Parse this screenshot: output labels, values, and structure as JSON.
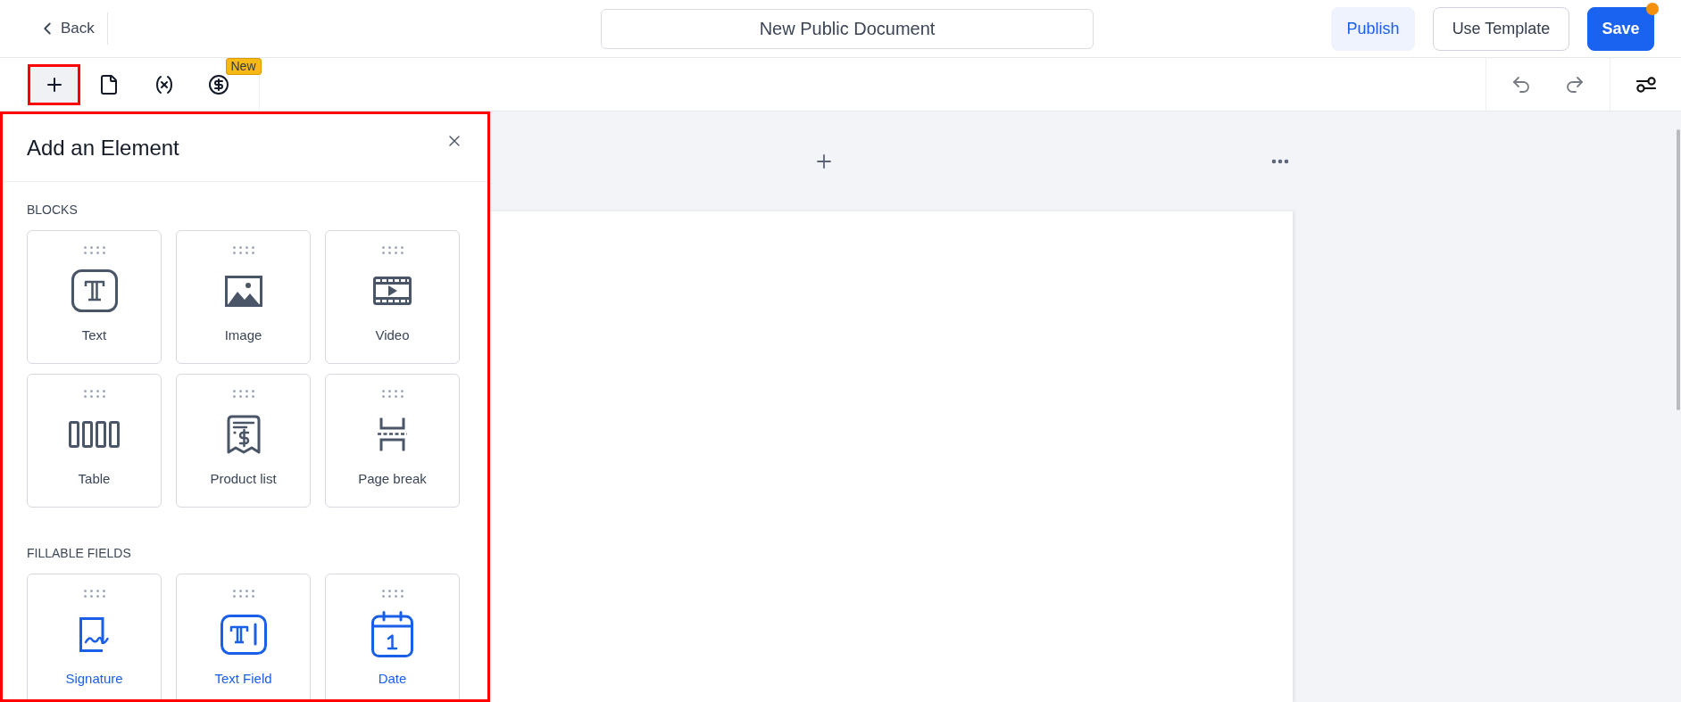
{
  "top_bar": {
    "back_link": {
      "label": "Back"
    },
    "document_title": {
      "value": "New Public Document"
    },
    "actions": [
      {
        "label": "Publish",
        "kind": "soft",
        "notification_dot": false
      },
      {
        "label": "Use Template",
        "kind": "outline",
        "notification_dot": false
      },
      {
        "label": "Save",
        "kind": "primary",
        "notification_dot": true
      }
    ]
  },
  "toolbar": {
    "tools": [
      {
        "kind": "add",
        "selected": true,
        "highlighted": true
      },
      {
        "kind": "page",
        "selected": false,
        "highlighted": false
      },
      {
        "kind": "variables",
        "selected": false,
        "highlighted": false
      },
      {
        "kind": "pricing",
        "selected": false,
        "highlighted": false,
        "badge": "New"
      }
    ],
    "history": [
      {
        "kind": "undo",
        "disabled": true
      },
      {
        "kind": "redo",
        "disabled": true
      }
    ]
  },
  "panel": {
    "title": "Add an Element",
    "highlighted": true,
    "sections": [
      {
        "heading": "BLOCKS",
        "kind": "blocks",
        "items": [
          {
            "label": "Text",
            "kind": "text"
          },
          {
            "label": "Image",
            "kind": "image"
          },
          {
            "label": "Video",
            "kind": "video"
          },
          {
            "label": "Table",
            "kind": "table"
          },
          {
            "label": "Product list",
            "kind": "product_list"
          },
          {
            "label": "Page break",
            "kind": "page_break"
          }
        ]
      },
      {
        "heading": "FILLABLE FIELDS",
        "kind": "fillable",
        "items": [
          {
            "label": "Signature",
            "kind": "signature"
          },
          {
            "label": "Text Field",
            "kind": "text_field"
          },
          {
            "label": "Date",
            "kind": "date"
          }
        ]
      }
    ]
  }
}
